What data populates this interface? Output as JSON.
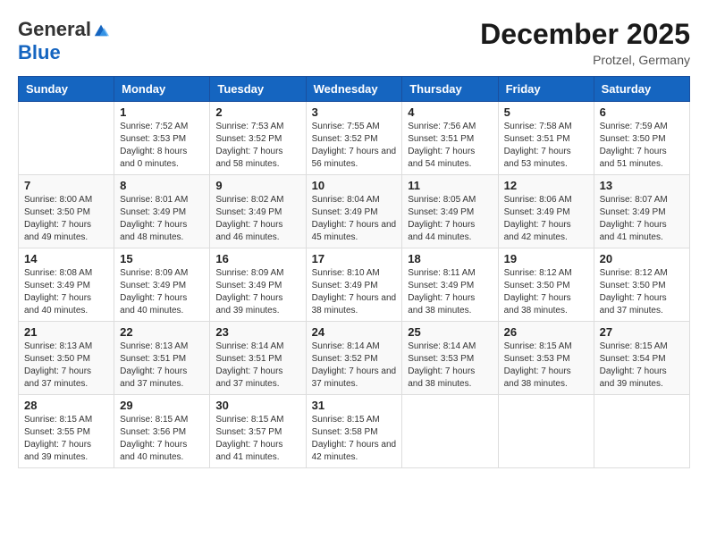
{
  "header": {
    "logo_general": "General",
    "logo_blue": "Blue",
    "month_title": "December 2025",
    "location": "Protzel, Germany"
  },
  "weekdays": [
    "Sunday",
    "Monday",
    "Tuesday",
    "Wednesday",
    "Thursday",
    "Friday",
    "Saturday"
  ],
  "weeks": [
    [
      {
        "day": "",
        "sunrise": "",
        "sunset": "",
        "daylight": ""
      },
      {
        "day": "1",
        "sunrise": "Sunrise: 7:52 AM",
        "sunset": "Sunset: 3:53 PM",
        "daylight": "Daylight: 8 hours and 0 minutes."
      },
      {
        "day": "2",
        "sunrise": "Sunrise: 7:53 AM",
        "sunset": "Sunset: 3:52 PM",
        "daylight": "Daylight: 7 hours and 58 minutes."
      },
      {
        "day": "3",
        "sunrise": "Sunrise: 7:55 AM",
        "sunset": "Sunset: 3:52 PM",
        "daylight": "Daylight: 7 hours and 56 minutes."
      },
      {
        "day": "4",
        "sunrise": "Sunrise: 7:56 AM",
        "sunset": "Sunset: 3:51 PM",
        "daylight": "Daylight: 7 hours and 54 minutes."
      },
      {
        "day": "5",
        "sunrise": "Sunrise: 7:58 AM",
        "sunset": "Sunset: 3:51 PM",
        "daylight": "Daylight: 7 hours and 53 minutes."
      },
      {
        "day": "6",
        "sunrise": "Sunrise: 7:59 AM",
        "sunset": "Sunset: 3:50 PM",
        "daylight": "Daylight: 7 hours and 51 minutes."
      }
    ],
    [
      {
        "day": "7",
        "sunrise": "Sunrise: 8:00 AM",
        "sunset": "Sunset: 3:50 PM",
        "daylight": "Daylight: 7 hours and 49 minutes."
      },
      {
        "day": "8",
        "sunrise": "Sunrise: 8:01 AM",
        "sunset": "Sunset: 3:49 PM",
        "daylight": "Daylight: 7 hours and 48 minutes."
      },
      {
        "day": "9",
        "sunrise": "Sunrise: 8:02 AM",
        "sunset": "Sunset: 3:49 PM",
        "daylight": "Daylight: 7 hours and 46 minutes."
      },
      {
        "day": "10",
        "sunrise": "Sunrise: 8:04 AM",
        "sunset": "Sunset: 3:49 PM",
        "daylight": "Daylight: 7 hours and 45 minutes."
      },
      {
        "day": "11",
        "sunrise": "Sunrise: 8:05 AM",
        "sunset": "Sunset: 3:49 PM",
        "daylight": "Daylight: 7 hours and 44 minutes."
      },
      {
        "day": "12",
        "sunrise": "Sunrise: 8:06 AM",
        "sunset": "Sunset: 3:49 PM",
        "daylight": "Daylight: 7 hours and 42 minutes."
      },
      {
        "day": "13",
        "sunrise": "Sunrise: 8:07 AM",
        "sunset": "Sunset: 3:49 PM",
        "daylight": "Daylight: 7 hours and 41 minutes."
      }
    ],
    [
      {
        "day": "14",
        "sunrise": "Sunrise: 8:08 AM",
        "sunset": "Sunset: 3:49 PM",
        "daylight": "Daylight: 7 hours and 40 minutes."
      },
      {
        "day": "15",
        "sunrise": "Sunrise: 8:09 AM",
        "sunset": "Sunset: 3:49 PM",
        "daylight": "Daylight: 7 hours and 40 minutes."
      },
      {
        "day": "16",
        "sunrise": "Sunrise: 8:09 AM",
        "sunset": "Sunset: 3:49 PM",
        "daylight": "Daylight: 7 hours and 39 minutes."
      },
      {
        "day": "17",
        "sunrise": "Sunrise: 8:10 AM",
        "sunset": "Sunset: 3:49 PM",
        "daylight": "Daylight: 7 hours and 38 minutes."
      },
      {
        "day": "18",
        "sunrise": "Sunrise: 8:11 AM",
        "sunset": "Sunset: 3:49 PM",
        "daylight": "Daylight: 7 hours and 38 minutes."
      },
      {
        "day": "19",
        "sunrise": "Sunrise: 8:12 AM",
        "sunset": "Sunset: 3:50 PM",
        "daylight": "Daylight: 7 hours and 38 minutes."
      },
      {
        "day": "20",
        "sunrise": "Sunrise: 8:12 AM",
        "sunset": "Sunset: 3:50 PM",
        "daylight": "Daylight: 7 hours and 37 minutes."
      }
    ],
    [
      {
        "day": "21",
        "sunrise": "Sunrise: 8:13 AM",
        "sunset": "Sunset: 3:50 PM",
        "daylight": "Daylight: 7 hours and 37 minutes."
      },
      {
        "day": "22",
        "sunrise": "Sunrise: 8:13 AM",
        "sunset": "Sunset: 3:51 PM",
        "daylight": "Daylight: 7 hours and 37 minutes."
      },
      {
        "day": "23",
        "sunrise": "Sunrise: 8:14 AM",
        "sunset": "Sunset: 3:51 PM",
        "daylight": "Daylight: 7 hours and 37 minutes."
      },
      {
        "day": "24",
        "sunrise": "Sunrise: 8:14 AM",
        "sunset": "Sunset: 3:52 PM",
        "daylight": "Daylight: 7 hours and 37 minutes."
      },
      {
        "day": "25",
        "sunrise": "Sunrise: 8:14 AM",
        "sunset": "Sunset: 3:53 PM",
        "daylight": "Daylight: 7 hours and 38 minutes."
      },
      {
        "day": "26",
        "sunrise": "Sunrise: 8:15 AM",
        "sunset": "Sunset: 3:53 PM",
        "daylight": "Daylight: 7 hours and 38 minutes."
      },
      {
        "day": "27",
        "sunrise": "Sunrise: 8:15 AM",
        "sunset": "Sunset: 3:54 PM",
        "daylight": "Daylight: 7 hours and 39 minutes."
      }
    ],
    [
      {
        "day": "28",
        "sunrise": "Sunrise: 8:15 AM",
        "sunset": "Sunset: 3:55 PM",
        "daylight": "Daylight: 7 hours and 39 minutes."
      },
      {
        "day": "29",
        "sunrise": "Sunrise: 8:15 AM",
        "sunset": "Sunset: 3:56 PM",
        "daylight": "Daylight: 7 hours and 40 minutes."
      },
      {
        "day": "30",
        "sunrise": "Sunrise: 8:15 AM",
        "sunset": "Sunset: 3:57 PM",
        "daylight": "Daylight: 7 hours and 41 minutes."
      },
      {
        "day": "31",
        "sunrise": "Sunrise: 8:15 AM",
        "sunset": "Sunset: 3:58 PM",
        "daylight": "Daylight: 7 hours and 42 minutes."
      },
      {
        "day": "",
        "sunrise": "",
        "sunset": "",
        "daylight": ""
      },
      {
        "day": "",
        "sunrise": "",
        "sunset": "",
        "daylight": ""
      },
      {
        "day": "",
        "sunrise": "",
        "sunset": "",
        "daylight": ""
      }
    ]
  ]
}
